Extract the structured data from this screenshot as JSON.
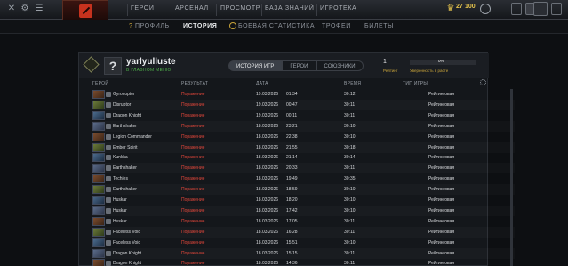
{
  "topnav": {
    "items": [
      "ГЕРОИ",
      "АРСЕНАЛ",
      "ПРОСМОТР",
      "БАЗА ЗНАНИЙ",
      "ИГРОТЕКА"
    ],
    "currency": "27",
    "shards": "100"
  },
  "subnav": {
    "items": [
      "ПРОФИЛЬ",
      "ИСТОРИЯ",
      "БОЕВАЯ СТАТИСТИКА",
      "ТРОФЕИ",
      "БИЛЕТЫ"
    ],
    "active_index": 1
  },
  "player": {
    "avatar_char": "?",
    "name": "yarlyulluste",
    "status": "В ГЛАВНОМ МЕНЮ"
  },
  "tabs": [
    "ИСТОРИЯ ИГР",
    "ГЕРОИ",
    "СОЮЗНИКИ"
  ],
  "summary": {
    "recent_count": "1",
    "recent_label": "Рейтинг",
    "winrate_text": "0%",
    "winrate_fraction": 0.0,
    "winrate_label": "Уверенность в расте"
  },
  "columns": {
    "hero": "ГЕРОЙ",
    "result": "РЕЗУЛЬТАТ",
    "date": "ДАТА",
    "duration": "ВРЕМЯ",
    "type": "ТИП ИГРЫ"
  },
  "matches": [
    {
      "hero": "Gyrocopter",
      "result": "Поражение",
      "date": "19.03.2026",
      "time": "01:34",
      "duration": "30:12",
      "type": "Рейтинговая"
    },
    {
      "hero": "Disruptor",
      "result": "Поражение",
      "date": "19.03.2026",
      "time": "00:47",
      "duration": "30:11",
      "type": "Рейтинговая"
    },
    {
      "hero": "Dragon Knight",
      "result": "Поражение",
      "date": "19.03.2026",
      "time": "00:11",
      "duration": "30:11",
      "type": "Рейтинговая"
    },
    {
      "hero": "Earthshaker",
      "result": "Поражение",
      "date": "18.03.2026",
      "time": "23:21",
      "duration": "30:10",
      "type": "Рейтинговая"
    },
    {
      "hero": "Legion Commander",
      "result": "Поражение",
      "date": "18.03.2026",
      "time": "22:38",
      "duration": "30:10",
      "type": "Рейтинговая"
    },
    {
      "hero": "Ember Spirit",
      "result": "Поражение",
      "date": "18.03.2026",
      "time": "21:55",
      "duration": "30:18",
      "type": "Рейтинговая"
    },
    {
      "hero": "Kunkka",
      "result": "Поражение",
      "date": "18.03.2026",
      "time": "21:14",
      "duration": "30:14",
      "type": "Рейтинговая"
    },
    {
      "hero": "Earthshaker",
      "result": "Поражение",
      "date": "18.03.2026",
      "time": "20:33",
      "duration": "30:11",
      "type": "Рейтинговая"
    },
    {
      "hero": "Techies",
      "result": "Поражение",
      "date": "18.03.2026",
      "time": "19:49",
      "duration": "30:35",
      "type": "Рейтинговая"
    },
    {
      "hero": "Earthshaker",
      "result": "Поражение",
      "date": "18.03.2026",
      "time": "18:59",
      "duration": "30:10",
      "type": "Рейтинговая"
    },
    {
      "hero": "Huskar",
      "result": "Поражение",
      "date": "18.03.2026",
      "time": "18:20",
      "duration": "30:10",
      "type": "Рейтинговая"
    },
    {
      "hero": "Huskar",
      "result": "Поражение",
      "date": "18.03.2026",
      "time": "17:42",
      "duration": "30:10",
      "type": "Рейтинговая"
    },
    {
      "hero": "Huskar",
      "result": "Поражение",
      "date": "18.03.2026",
      "time": "17:05",
      "duration": "30:11",
      "type": "Рейтинговая"
    },
    {
      "hero": "Faceless Void",
      "result": "Поражение",
      "date": "18.03.2026",
      "time": "16:28",
      "duration": "30:11",
      "type": "Рейтинговая"
    },
    {
      "hero": "Faceless Void",
      "result": "Поражение",
      "date": "18.03.2026",
      "time": "15:51",
      "duration": "30:10",
      "type": "Рейтинговая"
    },
    {
      "hero": "Dragon Knight",
      "result": "Поражение",
      "date": "18.03.2026",
      "time": "15:15",
      "duration": "30:11",
      "type": "Рейтинговая"
    },
    {
      "hero": "Dragon Knight",
      "result": "Поражение",
      "date": "18.03.2026",
      "time": "14:36",
      "duration": "30:11",
      "type": "Рейтинговая"
    }
  ]
}
